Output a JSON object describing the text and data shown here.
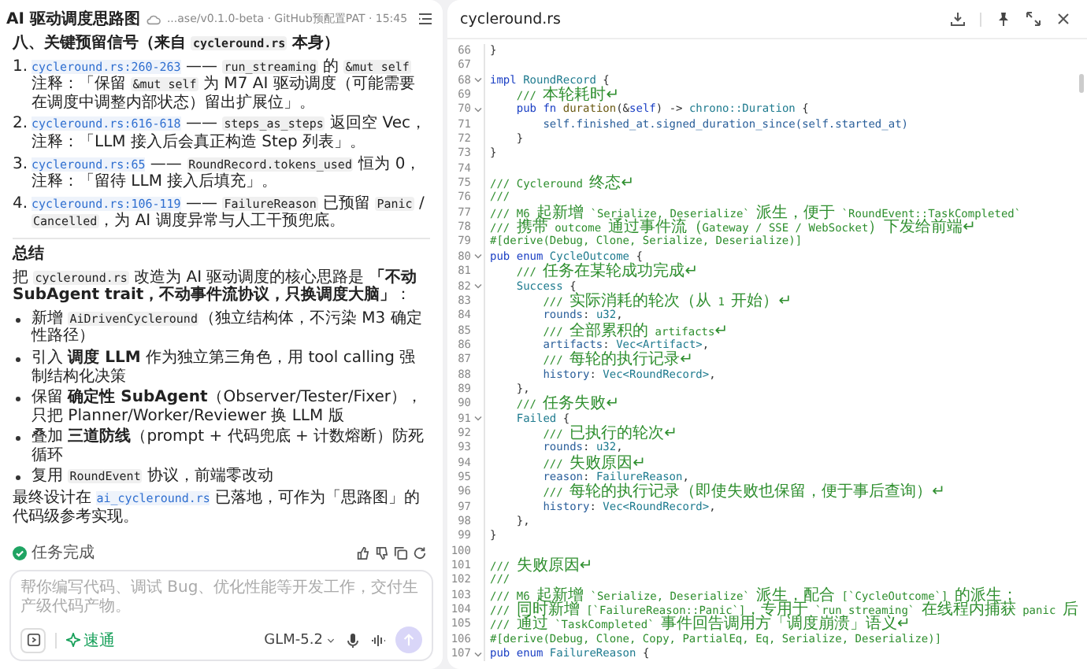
{
  "chat": {
    "title": "AI 驱动调度思路图",
    "subtitle": "...ase/v0.1.0-beta · GitHub预配置PAT · 15:45",
    "blocks": [
      {
        "kind": "heading",
        "segs": [
          {
            "kind": "text",
            "text": "八、关键预留信号（来自 "
          },
          {
            "kind": "code",
            "text": "cycleround.rs"
          },
          {
            "kind": "text",
            "text": " 本身）"
          }
        ]
      },
      {
        "kind": "ordered",
        "items": [
          {
            "marker": "1.",
            "segs": [
              {
                "kind": "link",
                "text": "cycleround.rs:260-263"
              },
              {
                "kind": "text",
                "text": " —— "
              },
              {
                "kind": "code",
                "text": "run_streaming"
              },
              {
                "kind": "text",
                "text": " 的 "
              },
              {
                "kind": "code",
                "text": "&mut self"
              },
              {
                "kind": "text",
                "text": " 注释：「保留 "
              },
              {
                "kind": "code",
                "text": "&mut self"
              },
              {
                "kind": "text",
                "text": " 为 M7 AI 驱动调度（可能需要在调度中调整内部状态）留出扩展位」。"
              }
            ]
          },
          {
            "marker": "2.",
            "segs": [
              {
                "kind": "link",
                "text": "cycleround.rs:616-618"
              },
              {
                "kind": "text",
                "text": " —— "
              },
              {
                "kind": "code",
                "text": "steps_as_steps"
              },
              {
                "kind": "text",
                "text": " 返回空 Vec，注释：「LLM 接入后会真正构造 Step 列表」。"
              }
            ]
          },
          {
            "marker": "3.",
            "segs": [
              {
                "kind": "link",
                "text": "cycleround.rs:65"
              },
              {
                "kind": "text",
                "text": " —— "
              },
              {
                "kind": "code",
                "text": "RoundRecord.tokens_used"
              },
              {
                "kind": "text",
                "text": " 恒为 0，注释：「留待 LLM 接入后填充」。"
              }
            ]
          },
          {
            "marker": "4.",
            "segs": [
              {
                "kind": "link",
                "text": "cycleround.rs:106-119"
              },
              {
                "kind": "text",
                "text": " —— "
              },
              {
                "kind": "code",
                "text": "FailureReason"
              },
              {
                "kind": "text",
                "text": " 已预留 "
              },
              {
                "kind": "code",
                "text": "Panic"
              },
              {
                "kind": "text",
                "text": " / "
              },
              {
                "kind": "code",
                "text": "Cancelled"
              },
              {
                "kind": "text",
                "text": "，为 AI 调度异常与人工干预兜底。"
              }
            ]
          }
        ]
      },
      {
        "kind": "rule"
      },
      {
        "kind": "heading",
        "segs": [
          {
            "kind": "text",
            "text": "总结"
          }
        ]
      },
      {
        "kind": "para",
        "segs": [
          {
            "kind": "text",
            "text": "把 "
          },
          {
            "kind": "code",
            "text": "cycleround.rs"
          },
          {
            "kind": "text",
            "text": " 改造为 AI 驱动调度的核心思路是 "
          },
          {
            "kind": "bold",
            "text": "「不动 SubAgent trait，不动事件流协议，只换调度大脑」"
          },
          {
            "kind": "text",
            "text": "："
          }
        ]
      },
      {
        "kind": "bullets",
        "items": [
          {
            "segs": [
              {
                "kind": "text",
                "text": "新增 "
              },
              {
                "kind": "code",
                "text": "AiDrivenCycleround"
              },
              {
                "kind": "text",
                "text": "（独立结构体，不污染 M3 确定性路径）"
              }
            ]
          },
          {
            "segs": [
              {
                "kind": "text",
                "text": "引入 "
              },
              {
                "kind": "bold",
                "text": "调度 LLM"
              },
              {
                "kind": "text",
                "text": " 作为独立第三角色，用 tool calling 强制结构化决策"
              }
            ]
          },
          {
            "segs": [
              {
                "kind": "text",
                "text": "保留 "
              },
              {
                "kind": "bold",
                "text": "确定性 SubAgent"
              },
              {
                "kind": "text",
                "text": "（Observer/Tester/Fixer），只把 Planner/Worker/Reviewer 换 LLM 版"
              }
            ]
          },
          {
            "segs": [
              {
                "kind": "text",
                "text": "叠加 "
              },
              {
                "kind": "bold",
                "text": "三道防线"
              },
              {
                "kind": "text",
                "text": "（prompt + 代码兜底 + 计数熔断）防死循环"
              }
            ]
          },
          {
            "segs": [
              {
                "kind": "text",
                "text": "复用 "
              },
              {
                "kind": "code",
                "text": "RoundEvent"
              },
              {
                "kind": "text",
                "text": " 协议，前端零改动"
              }
            ]
          }
        ]
      },
      {
        "kind": "para",
        "segs": [
          {
            "kind": "text",
            "text": "最终设计在 "
          },
          {
            "kind": "link",
            "text": "ai_cycleround.rs"
          },
          {
            "kind": "text",
            "text": " 已落地，可作为「思路图」的代码级参考实现。"
          }
        ]
      }
    ],
    "status": "任务完成"
  },
  "input": {
    "placeholder": "帮你编写代码、调试 Bug、优化性能等开发工作，交付生产级代码产物。",
    "mode": "速通",
    "model": "GLM-5.2",
    "send_enabled": false
  },
  "code": {
    "file": "cycleround.rs",
    "lines": [
      {
        "n": "66",
        "tokens": [
          {
            "kind": "punct",
            "text": "}"
          }
        ]
      },
      {
        "n": "67"
      },
      {
        "n": "68",
        "fold": true,
        "tokens": [
          {
            "kind": "keyword",
            "text": "impl"
          },
          {
            "kind": "type",
            "text": " RoundRecord"
          },
          {
            "kind": "punct",
            "text": " {"
          }
        ]
      },
      {
        "n": "69",
        "tokens": [
          {
            "kind": "comment",
            "text": "    /// 本轮耗时↵"
          }
        ]
      },
      {
        "n": "70",
        "fold": true,
        "tokens": [
          {
            "kind": "keyword",
            "text": "    pub fn"
          },
          {
            "kind": "function",
            "text": " duration"
          },
          {
            "kind": "punct",
            "text": "(&"
          },
          {
            "kind": "keyword",
            "text": "self"
          },
          {
            "kind": "punct",
            "text": ") -> "
          },
          {
            "kind": "type",
            "text": "chrono::Duration"
          },
          {
            "kind": "punct",
            "text": " {"
          }
        ]
      },
      {
        "n": "71",
        "tokens": [
          {
            "kind": "variable",
            "text": "        self.finished_at.signed_duration_since(self.started_at)"
          }
        ]
      },
      {
        "n": "72",
        "tokens": [
          {
            "kind": "punct",
            "text": "    }"
          }
        ]
      },
      {
        "n": "73",
        "tokens": [
          {
            "kind": "punct",
            "text": "}"
          }
        ]
      },
      {
        "n": "74"
      },
      {
        "n": "75",
        "tokens": [
          {
            "kind": "comment",
            "text": "/// Cycleround 终态↵"
          }
        ]
      },
      {
        "n": "76",
        "tokens": [
          {
            "kind": "comment",
            "text": "///"
          }
        ]
      },
      {
        "n": "77",
        "tokens": [
          {
            "kind": "comment",
            "text": "/// M6 起新增 `Serialize, Deserialize` 派生，便于 `RoundEvent::TaskCompleted`"
          }
        ]
      },
      {
        "n": "78",
        "tokens": [
          {
            "kind": "comment",
            "text": "/// 携带 outcome 通过事件流（Gateway / SSE / WebSocket）下发给前端↵"
          }
        ]
      },
      {
        "n": "79",
        "tokens": [
          {
            "kind": "attribute",
            "text": "#[derive(Debug, Clone, Serialize, Deserialize)]"
          }
        ]
      },
      {
        "n": "80",
        "fold": true,
        "tokens": [
          {
            "kind": "keyword",
            "text": "pub enum"
          },
          {
            "kind": "type",
            "text": " CycleOutcome"
          },
          {
            "kind": "punct",
            "text": " {"
          }
        ]
      },
      {
        "n": "81",
        "tokens": [
          {
            "kind": "comment",
            "text": "    /// 任务在某轮成功完成↵"
          }
        ]
      },
      {
        "n": "82",
        "fold": true,
        "tokens": [
          {
            "kind": "type",
            "text": "    Success"
          },
          {
            "kind": "punct",
            "text": " {"
          }
        ]
      },
      {
        "n": "83",
        "tokens": [
          {
            "kind": "comment",
            "text": "        /// 实际消耗的轮次（从 1 开始）↵"
          }
        ]
      },
      {
        "n": "84",
        "tokens": [
          {
            "kind": "variable",
            "text": "        rounds"
          },
          {
            "kind": "punct",
            "text": ": "
          },
          {
            "kind": "type",
            "text": "u32"
          },
          {
            "kind": "punct",
            "text": ","
          }
        ]
      },
      {
        "n": "85",
        "tokens": [
          {
            "kind": "comment",
            "text": "        /// 全部累积的 artifacts↵"
          }
        ]
      },
      {
        "n": "86",
        "tokens": [
          {
            "kind": "variable",
            "text": "        artifacts"
          },
          {
            "kind": "punct",
            "text": ": "
          },
          {
            "kind": "type",
            "text": "Vec<Artifact>"
          },
          {
            "kind": "punct",
            "text": ","
          }
        ]
      },
      {
        "n": "87",
        "tokens": [
          {
            "kind": "comment",
            "text": "        /// 每轮的执行记录↵"
          }
        ]
      },
      {
        "n": "88",
        "tokens": [
          {
            "kind": "variable",
            "text": "        history"
          },
          {
            "kind": "punct",
            "text": ": "
          },
          {
            "kind": "type",
            "text": "Vec<RoundRecord>"
          },
          {
            "kind": "punct",
            "text": ","
          }
        ]
      },
      {
        "n": "89",
        "tokens": [
          {
            "kind": "punct",
            "text": "    },"
          }
        ]
      },
      {
        "n": "90",
        "tokens": [
          {
            "kind": "comment",
            "text": "    /// 任务失败↵"
          }
        ]
      },
      {
        "n": "91",
        "fold": true,
        "tokens": [
          {
            "kind": "type",
            "text": "    Failed"
          },
          {
            "kind": "punct",
            "text": " {"
          }
        ]
      },
      {
        "n": "92",
        "tokens": [
          {
            "kind": "comment",
            "text": "        /// 已执行的轮次↵"
          }
        ]
      },
      {
        "n": "93",
        "tokens": [
          {
            "kind": "variable",
            "text": "        rounds"
          },
          {
            "kind": "punct",
            "text": ": "
          },
          {
            "kind": "type",
            "text": "u32"
          },
          {
            "kind": "punct",
            "text": ","
          }
        ]
      },
      {
        "n": "94",
        "tokens": [
          {
            "kind": "comment",
            "text": "        /// 失败原因↵"
          }
        ]
      },
      {
        "n": "95",
        "tokens": [
          {
            "kind": "variable",
            "text": "        reason"
          },
          {
            "kind": "punct",
            "text": ": "
          },
          {
            "kind": "type",
            "text": "FailureReason"
          },
          {
            "kind": "punct",
            "text": ","
          }
        ]
      },
      {
        "n": "96",
        "tokens": [
          {
            "kind": "comment",
            "text": "        /// 每轮的执行记录（即使失败也保留，便于事后查询）↵"
          }
        ]
      },
      {
        "n": "97",
        "tokens": [
          {
            "kind": "variable",
            "text": "        history"
          },
          {
            "kind": "punct",
            "text": ": "
          },
          {
            "kind": "type",
            "text": "Vec<RoundRecord>"
          },
          {
            "kind": "punct",
            "text": ","
          }
        ]
      },
      {
        "n": "98",
        "tokens": [
          {
            "kind": "punct",
            "text": "    },"
          }
        ]
      },
      {
        "n": "99",
        "tokens": [
          {
            "kind": "punct",
            "text": "}"
          }
        ]
      },
      {
        "n": "100"
      },
      {
        "n": "101",
        "tokens": [
          {
            "kind": "comment",
            "text": "/// 失败原因↵"
          }
        ]
      },
      {
        "n": "102",
        "tokens": [
          {
            "kind": "comment",
            "text": "///"
          }
        ]
      },
      {
        "n": "103",
        "tokens": [
          {
            "kind": "comment",
            "text": "/// M6 起新增 `Serialize, Deserialize` 派生，配合 [`CycleOutcome`] 的派生；"
          }
        ]
      },
      {
        "n": "104",
        "tokens": [
          {
            "kind": "comment",
            "text": "/// 同时新增 [`FailureReason::Panic`]，专用于 `run_streaming` 在线程内捕获 panic 后"
          }
        ]
      },
      {
        "n": "105",
        "tokens": [
          {
            "kind": "comment",
            "text": "/// 通过 `TaskCompleted` 事件回告调用方「调度崩溃」语义↵"
          }
        ]
      },
      {
        "n": "106",
        "tokens": [
          {
            "kind": "attribute",
            "text": "#[derive(Debug, Clone, Copy, PartialEq, Eq, Serialize, Deserialize)]"
          }
        ]
      },
      {
        "n": "107",
        "fold": true,
        "tokens": [
          {
            "kind": "keyword",
            "text": "pub enum"
          },
          {
            "kind": "type",
            "text": " FailureReason"
          },
          {
            "kind": "punct",
            "text": " {"
          }
        ]
      }
    ]
  }
}
